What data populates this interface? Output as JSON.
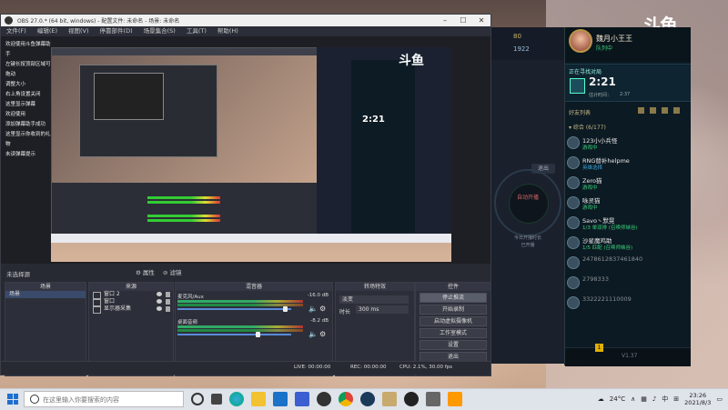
{
  "obs": {
    "title": "OBS 27.0.* (64 bit, windows) - 配置文件: 未命名 - 场景: 未命名",
    "menu": [
      "文件(F)",
      "编辑(E)",
      "视图(V)",
      "停靠部件(D)",
      "场景集合(S)",
      "工具(T)",
      "帮助(H)"
    ],
    "notes": [
      "欢迎使用斗鱼弹幕助手",
      "左键长按顶部区域可拖动",
      "调整大小",
      "右上角设置关闭",
      "这里显示弹幕",
      "欢迎使用",
      "添加弹幕助手成功",
      "这里显示你收到的礼物",
      "未读弹幕提示"
    ],
    "capture_logo": "斗鱼",
    "mini_timer": "2:21",
    "no_source_label": "未选择源",
    "properties_label": "属性",
    "filters_label": "滤镜",
    "scenes_header": "场景",
    "sources_header": "来源",
    "mixer_header": "混音器",
    "transitions_header": "转场特效",
    "controls_header": "控件",
    "scenes": [
      "场景"
    ],
    "sources": [
      {
        "name": "窗口 2",
        "icon": "window-icon"
      },
      {
        "name": "窗口",
        "icon": "window-icon"
      },
      {
        "name": "显示器采集",
        "icon": "monitor-icon"
      }
    ],
    "mixer": [
      {
        "name": "麦克风/Aux",
        "db": "-16.0 dB"
      },
      {
        "name": "桌面音频",
        "db": "-8.2 dB"
      }
    ],
    "transition": {
      "value": "淡变",
      "duration_label": "时长",
      "duration": "300 ms"
    },
    "controls": [
      "停止推流",
      "开始录制",
      "启动虚拟摄像机",
      "工作室模式",
      "设置",
      "退出"
    ],
    "status": {
      "live": "LIVE: 00:00:00",
      "rec": "REC: 00:00:00",
      "cpu": "CPU: 2.1%, 30.00 fps"
    }
  },
  "douyu": {
    "logo": "斗鱼",
    "coins": "80",
    "coins2": "1922",
    "circle_text": "自动开播",
    "tip1": "今日开播时长",
    "tip2": "已开播",
    "button": "退出"
  },
  "lol": {
    "username": "魏月小王王",
    "user_status": "队列中",
    "timer_label": "正在寻找对局",
    "timer": "2:21",
    "estimated_label": "估计时间：",
    "estimated": "2:37",
    "friends_title": "好友列表",
    "group": "▾ 综合 (6/177)",
    "friends": [
      {
        "name": "123小小兵怪",
        "status": "游戏中",
        "cls": ""
      },
      {
        "name": "RNG替补helpme",
        "status": "英雄选择",
        "cls": "away"
      },
      {
        "name": "Zero猫",
        "status": "游戏中",
        "cls": ""
      },
      {
        "name": "咏灵猫",
        "status": "游戏中",
        "cls": ""
      },
      {
        "name": "Savo丶默晃",
        "status": "1/3 单双排 (召唤师峡谷)",
        "cls": ""
      },
      {
        "name": "沙星魔鸡助",
        "status": "1/5 匹配 (召唤师峡谷)",
        "cls": ""
      },
      {
        "name": "2478612837461840",
        "status": "",
        "cls": ""
      },
      {
        "name": "2798333",
        "status": "",
        "cls": ""
      },
      {
        "name": "3322221110009",
        "status": "",
        "cls": ""
      }
    ],
    "version": "V1.37",
    "badge": "1"
  },
  "taskbar": {
    "search_placeholder": "在这里输入你要搜索的内容",
    "temp": "24°C",
    "lang": "中",
    "time": "23:26",
    "date": "2021/8/3"
  },
  "colors": {
    "obs_bg": "#272a33",
    "lol_bg": "#0c1a23",
    "accent_green": "#3ad07c",
    "gold": "#c8b88a"
  }
}
